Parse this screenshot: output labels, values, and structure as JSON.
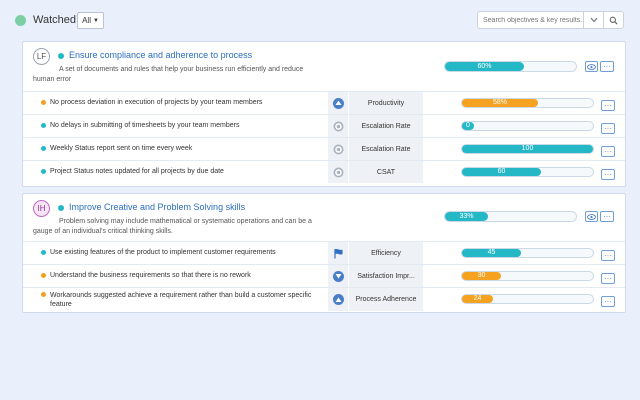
{
  "header": {
    "title": "Watched",
    "filter_label": "All",
    "search_placeholder": "Search objectives & key results..."
  },
  "objectives": [
    {
      "avatar": "LF",
      "title": "Ensure compliance and adherence to process",
      "description": "A set of documents and rules that help your business run efficiently and reduce human error",
      "progress": 60,
      "progress_label": "60%",
      "key_results": [
        {
          "text": "No process deviation in execution of projects by your team members",
          "status_color": "#f0a020",
          "icon": "up-arrow-circle-icon",
          "metric": "Productivity",
          "progress": 58,
          "progress_label": "58%",
          "bar_color": "#f4a21f"
        },
        {
          "text": "No delays in submitting of timesheets by your team members",
          "status_color": "#24b8c6",
          "icon": "target-icon",
          "metric": "Escalation Rate",
          "progress": 0,
          "progress_label": "0",
          "bar_color": "#24b8c6"
        },
        {
          "text": "Weekly Status report sent on time every week",
          "status_color": "#24b8c6",
          "icon": "target-icon",
          "metric": "Escalation Rate",
          "progress": 100,
          "progress_label": "100",
          "bar_color": "#24b8c6"
        },
        {
          "text": "Project Status notes updated for all projects by due date",
          "status_color": "#24b8c6",
          "icon": "target-icon",
          "metric": "CSAT",
          "progress": 60,
          "progress_label": "60",
          "bar_color": "#24b8c6"
        }
      ]
    },
    {
      "avatar": "IH",
      "title": "Improve Creative and Problem Solving skills",
      "description": "Problem solving may include mathematical or systematic operations and can be a gauge of an individual's critical thinking skills.",
      "progress": 33,
      "progress_label": "33%",
      "key_results": [
        {
          "text": "Use existing features of the product to implement customer requirements",
          "status_color": "#24b8c6",
          "icon": "flag-icon",
          "metric": "Efficiency",
          "progress": 45,
          "progress_label": "45",
          "bar_color": "#24b8c6"
        },
        {
          "text": "Understand the business requirements so that there is no rework",
          "status_color": "#f0a020",
          "icon": "down-arrow-circle-icon",
          "metric": "Satisfaction Impr...",
          "progress": 30,
          "progress_label": "30",
          "bar_color": "#f4a21f"
        },
        {
          "text": "Workarounds suggested achieve a requirement rather than build a customer specific feature",
          "status_color": "#f0a020",
          "icon": "up-arrow-circle-icon",
          "metric": "Process Adherence",
          "progress": 24,
          "progress_label": "24",
          "bar_color": "#f4a21f"
        }
      ]
    }
  ]
}
